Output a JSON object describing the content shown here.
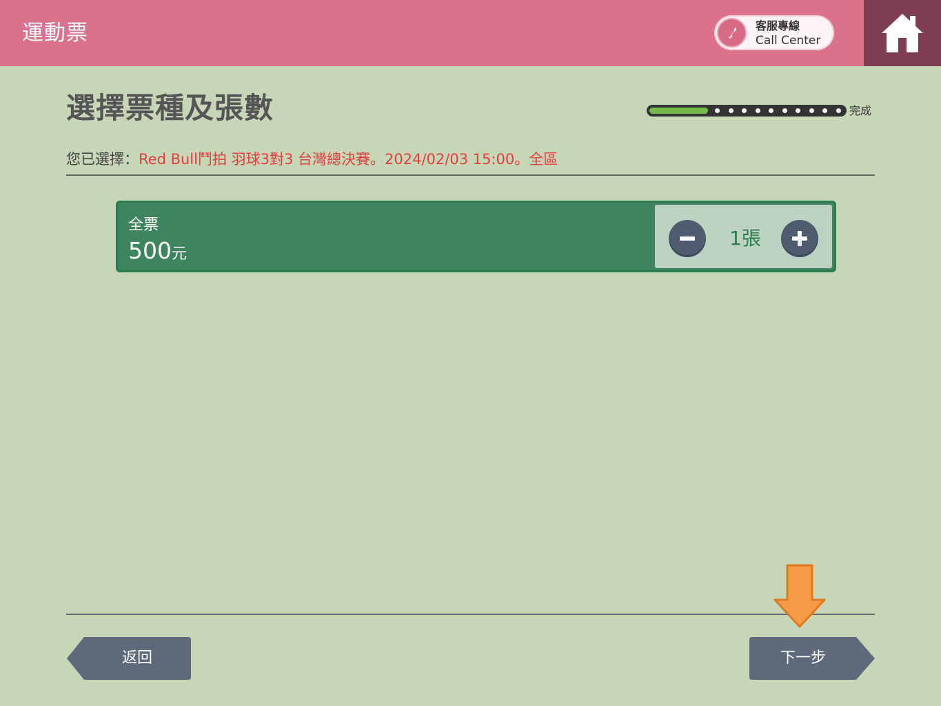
{
  "header": {
    "title": "運動票",
    "call_center": {
      "label_zh": "客服專線",
      "label_en": "Call Center",
      "icon": "phone-icon"
    },
    "home_icon": "home-icon"
  },
  "page": {
    "title": "選擇票種及張數",
    "progress": {
      "step_fraction": 0.3,
      "end_label": "完成"
    },
    "selection": {
      "label": "您已選擇：",
      "value": "Red Bull鬥拍 羽球3對3 台灣總決賽。2024/02/03 15:00。全區"
    }
  },
  "tickets": [
    {
      "type": "全票",
      "price": "500",
      "currency": "元",
      "quantity": "1張",
      "minus_icon": "minus-icon",
      "plus_icon": "plus-icon"
    }
  ],
  "footer": {
    "back_label": "返回",
    "next_label": "下一步",
    "hint_icon": "down-arrow-icon"
  },
  "colors": {
    "header": "#db718b",
    "home": "#7c3e50",
    "background": "#c6d6b7",
    "ticket": "#3e855f",
    "highlight_text": "#e0403f",
    "nav_button": "#5e6a7c",
    "hint_arrow": "#f59a46"
  }
}
